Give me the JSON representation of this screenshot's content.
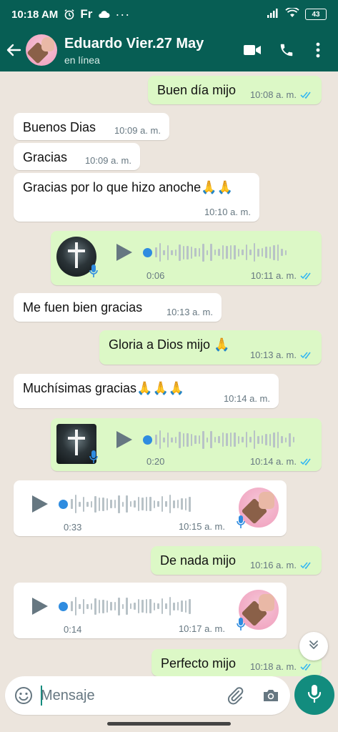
{
  "status_bar": {
    "time": "10:18 AM",
    "carrier_text": "Fr",
    "more_dots": "···",
    "battery": "43",
    "icons": [
      "alarm-icon",
      "cloud-icon",
      "signal-icon",
      "wifi-icon",
      "battery-icon"
    ]
  },
  "header": {
    "contact_name": "Eduardo Vier.27 May",
    "presence": "en línea",
    "icons": [
      "back-arrow-icon",
      "video-call-icon",
      "phone-icon",
      "more-options-icon"
    ]
  },
  "messages": [
    {
      "dir": "out",
      "kind": "text",
      "text": "Buen día mijo",
      "time": "10:08 a. m.",
      "read": true
    },
    {
      "dir": "in",
      "kind": "text",
      "text": "Buenos Dias",
      "time": "10:09 a. m."
    },
    {
      "dir": "in",
      "kind": "text",
      "text": "Gracias",
      "time": "10:09 a. m."
    },
    {
      "dir": "in",
      "kind": "text",
      "text": "Gracias por lo que hizo anoche🙏🙏",
      "time": "10:10 a. m."
    },
    {
      "dir": "out",
      "kind": "voice",
      "duration": "0:06",
      "time": "10:11 a. m.",
      "read": true,
      "thumb": "cross-image"
    },
    {
      "dir": "in",
      "kind": "text",
      "text": "Me fuen bien gracias",
      "time": "10:13 a. m."
    },
    {
      "dir": "out",
      "kind": "text",
      "text": "Gloria a Dios mijo 🙏",
      "time": "10:13 a. m.",
      "read": true
    },
    {
      "dir": "in",
      "kind": "text",
      "text": "Muchísimas gracias🙏🙏🙏",
      "time": "10:14 a. m."
    },
    {
      "dir": "out",
      "kind": "voice",
      "duration": "0:20",
      "time": "10:14 a. m.",
      "read": true,
      "thumb": "cross-image"
    },
    {
      "dir": "in",
      "kind": "voice",
      "duration": "0:33",
      "time": "10:15 a. m.",
      "thumb": "contact-avatar"
    },
    {
      "dir": "out",
      "kind": "text",
      "text": "De nada mijo",
      "time": "10:16 a. m.",
      "read": true
    },
    {
      "dir": "in",
      "kind": "voice",
      "duration": "0:14",
      "time": "10:17 a. m.",
      "thumb": "contact-avatar"
    },
    {
      "dir": "out",
      "kind": "text",
      "text": "Perfecto mijo",
      "time": "10:18 a. m.",
      "read": true
    }
  ],
  "composer": {
    "placeholder": "Mensaje",
    "icons": [
      "emoji-icon",
      "attach-icon",
      "camera-icon",
      "mic-icon"
    ]
  },
  "colors": {
    "header_bg": "#075e54",
    "chat_bg": "#ece5dd",
    "outgoing_bubble": "#dcf8c6",
    "incoming_bubble": "#ffffff",
    "read_ticks": "#34b7f1",
    "accent": "#128c7e",
    "voice_dot": "#2f8ce0"
  }
}
